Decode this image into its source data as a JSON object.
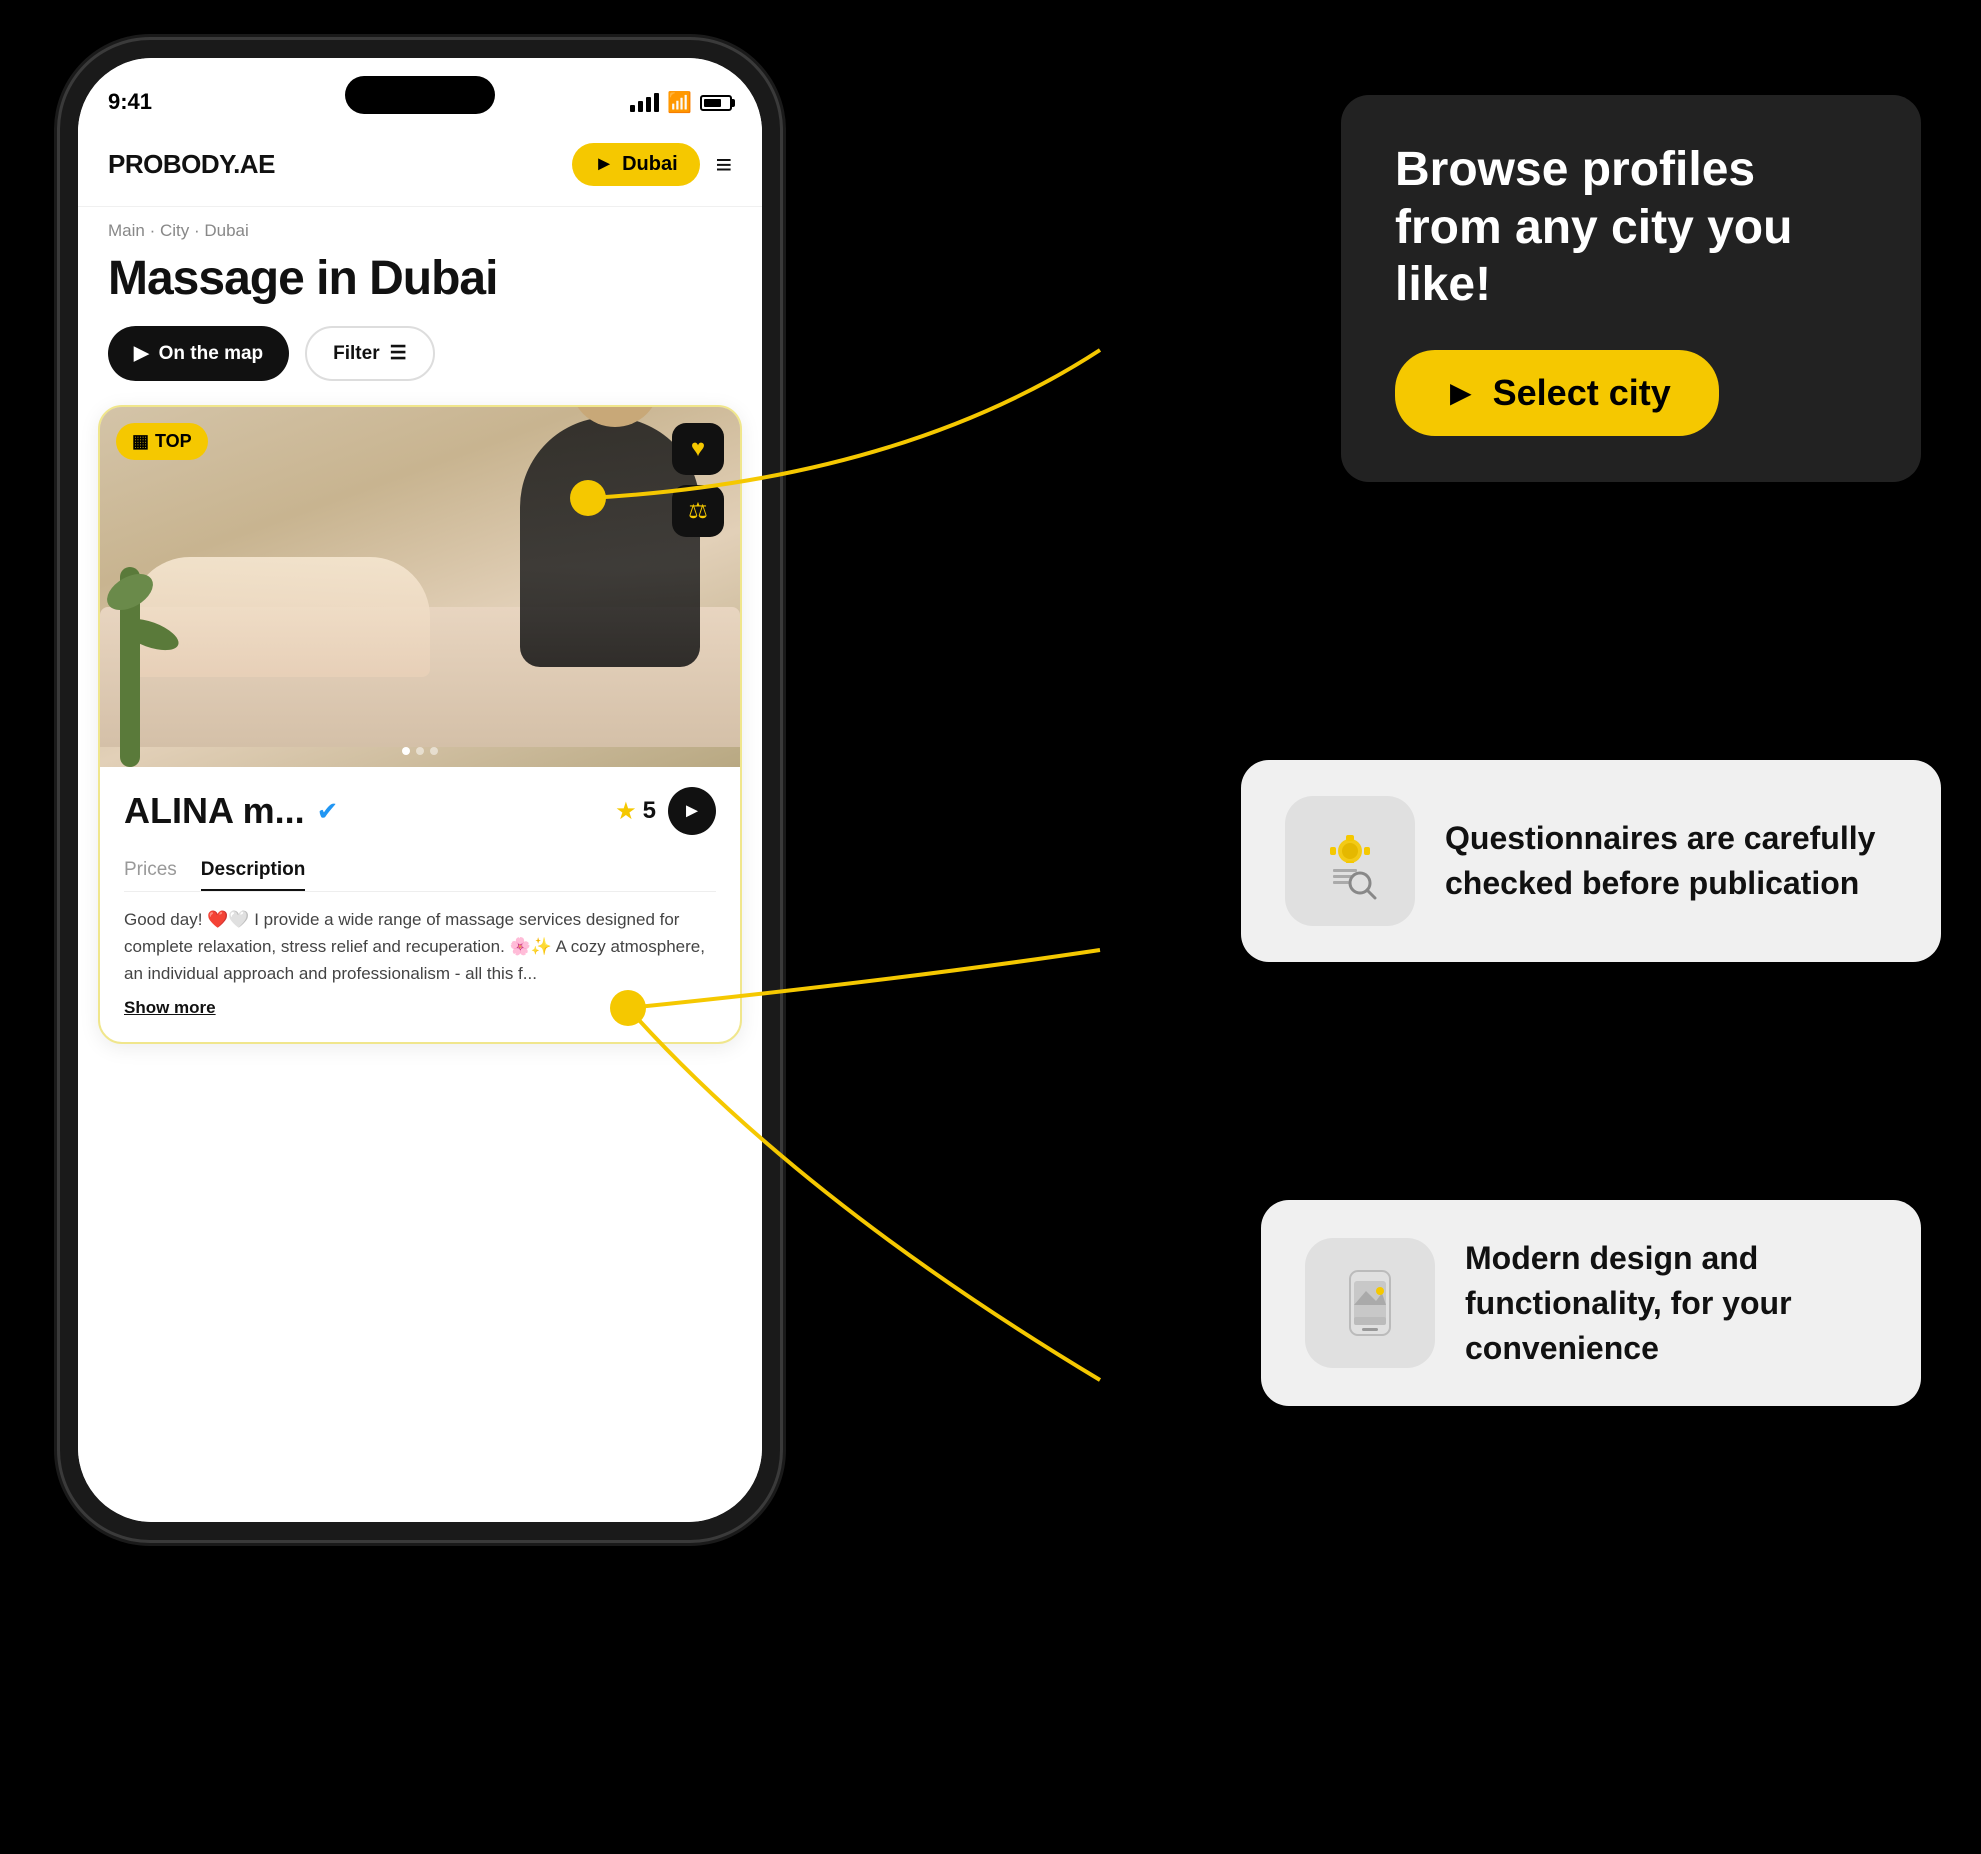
{
  "app": {
    "logo": "PROBODY.AE",
    "city_btn": "Dubai",
    "hamburger": "≡",
    "status_time": "9:41",
    "breadcrumb": "Main · City · Dubai",
    "page_title": "Massage in Dubai",
    "map_btn": "On the map",
    "filter_btn": "Filter",
    "top_badge": "TOP",
    "profile_name": "ALINA m...",
    "rating": "5",
    "tab_prices": "Prices",
    "tab_description": "Description",
    "description": "Good day! ❤️🤍 I provide a wide range of massage services designed for complete relaxation, stress relief and recuperation. 🌸✨ A cozy atmosphere, an individual approach and professionalism - all this f...",
    "show_more": "Show more"
  },
  "callouts": {
    "dark": {
      "title": "Browse profiles from any city you like!",
      "btn": "Select city"
    },
    "white1": {
      "text": "Questionnaires are carefully checked before publication",
      "icon": "🔍"
    },
    "white2": {
      "text": "Modern design and functionality, for your convenience",
      "icon": "📱"
    }
  },
  "colors": {
    "accent": "#f5c800",
    "dark": "#1a1a1a",
    "card_border": "#f0e68c"
  }
}
